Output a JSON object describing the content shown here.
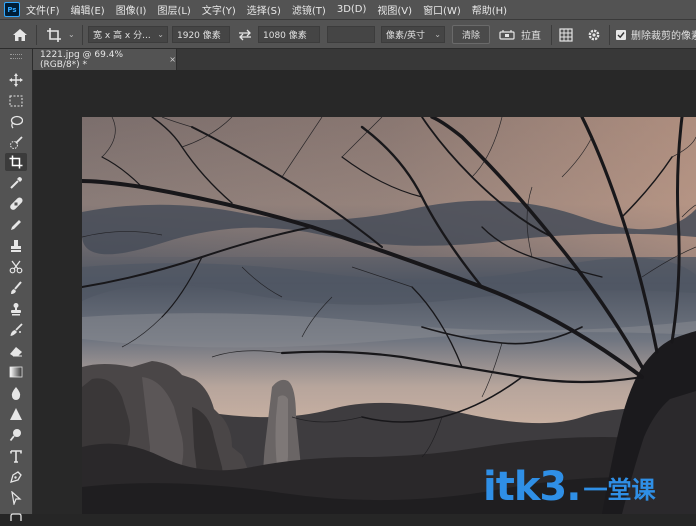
{
  "app": {
    "logo": "Ps"
  },
  "menu": [
    "文件(F)",
    "编辑(E)",
    "图像(I)",
    "图层(L)",
    "文字(Y)",
    "选择(S)",
    "滤镜(T)",
    "3D(D)",
    "视图(V)",
    "窗口(W)",
    "帮助(H)"
  ],
  "options": {
    "ratio_preset": "宽 x 高 x 分...",
    "width_value": "1920 像素",
    "height_value": "1080 像素",
    "resolution_value": "",
    "resolution_unit": "像素/英寸",
    "clear_label": "清除",
    "straighten_label": "拉直",
    "delete_cropped_label": "删除裁剪的像素",
    "delete_cropped_checked": true
  },
  "document": {
    "tab_title": "1221.jpg @ 69.4%(RGB/8*) *",
    "close_glyph": "×"
  },
  "watermark": {
    "latin": "itk3",
    "dot": ".",
    "cjk": "一堂课",
    "color": "#2f8fe6"
  },
  "colors": {
    "menubar": "#535353",
    "workspace": "#282828",
    "accent": "#31a8ff"
  }
}
